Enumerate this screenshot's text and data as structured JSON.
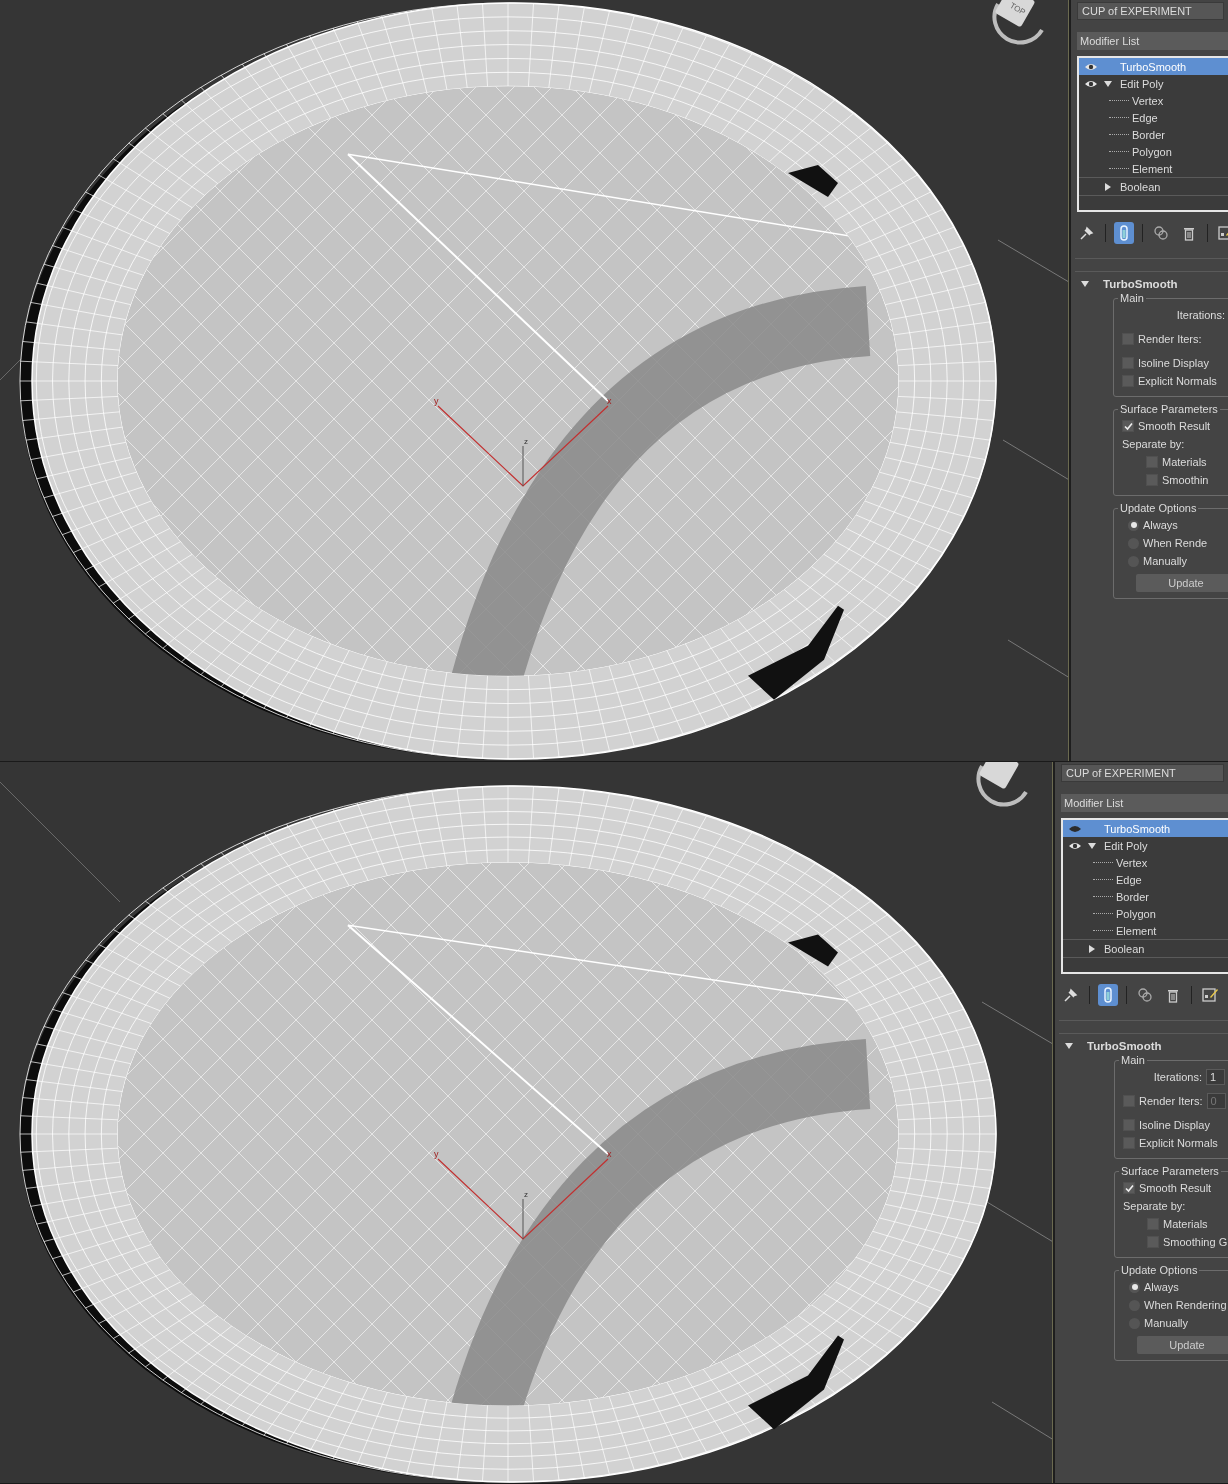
{
  "panes": [
    {
      "viewport": {
        "viewcube_label": "TOP",
        "axis_labels": [
          "y",
          "x",
          "z"
        ]
      },
      "panel": {
        "object_name": "CUP of EXPERIMENT",
        "modifier_list": "Modifier List",
        "stack": [
          {
            "label": "TurboSmooth",
            "visible": true,
            "selected": true
          },
          {
            "label": "Edit Poly",
            "visible": true,
            "selected": false,
            "expanded": true,
            "children": [
              {
                "label": "Vertex"
              },
              {
                "label": "Edge"
              },
              {
                "label": "Border"
              },
              {
                "label": "Polygon"
              },
              {
                "label": "Element"
              }
            ]
          },
          {
            "label": "Boolean",
            "selected": false,
            "expanded": false
          }
        ],
        "toolbar": [
          {
            "kind": "pin",
            "selected": false
          },
          {
            "kind": "show-end-result",
            "selected": true
          },
          {
            "kind": "make-unique",
            "selected": false
          },
          {
            "kind": "remove",
            "selected": false
          },
          {
            "kind": "configure",
            "selected": false
          }
        ],
        "rollout": {
          "title": "TurboSmooth",
          "expanded": true,
          "groups": [
            {
              "title": "Main",
              "controls": [
                {
                  "kind": "spinner",
                  "label": "Iterations:"
                },
                {
                  "kind": "checkbox",
                  "label": "Render Iters:",
                  "checked": false
                },
                {
                  "kind": "checkbox",
                  "label": "Isoline Display",
                  "checked": false
                },
                {
                  "kind": "checkbox",
                  "label": "Explicit Normals",
                  "checked": false
                }
              ]
            },
            {
              "title": "Surface Parameters",
              "controls": [
                {
                  "kind": "checkbox",
                  "label": "Smooth Result",
                  "checked": true
                },
                {
                  "kind": "label",
                  "label": "Separate by:",
                  "children": [
                    {
                      "label": "Materials",
                      "checked": false
                    },
                    {
                      "label": "Smoothin",
                      "checked": false
                    }
                  ]
                }
              ]
            },
            {
              "title": "Update Options",
              "controls": [
                {
                  "kind": "radio",
                  "label": "Always",
                  "selected": true
                },
                {
                  "kind": "radio",
                  "label": "When Rende",
                  "selected": false
                },
                {
                  "kind": "radio",
                  "label": "Manually",
                  "selected": false
                },
                {
                  "kind": "button",
                  "label": "Update"
                }
              ]
            }
          ]
        }
      }
    },
    {
      "viewport": {
        "axis_labels": [
          "y",
          "x",
          "z"
        ]
      },
      "panel": {
        "object_name": "CUP of EXPERIMENT",
        "modifier_list": "Modifier List",
        "stack": [
          {
            "label": "TurboSmooth",
            "visible": false,
            "selected": true
          },
          {
            "label": "Edit Poly",
            "visible": true,
            "selected": false,
            "expanded": true,
            "children": [
              {
                "label": "Vertex"
              },
              {
                "label": "Edge"
              },
              {
                "label": "Border"
              },
              {
                "label": "Polygon"
              },
              {
                "label": "Element"
              }
            ]
          },
          {
            "label": "Boolean",
            "selected": false,
            "expanded": false
          }
        ],
        "toolbar": [
          {
            "kind": "pin",
            "selected": false
          },
          {
            "kind": "show-end-result",
            "selected": true
          },
          {
            "kind": "make-unique",
            "selected": false
          },
          {
            "kind": "remove",
            "selected": false
          },
          {
            "kind": "configure",
            "selected": false
          }
        ],
        "rollout": {
          "title": "TurboSmooth",
          "expanded": true,
          "groups": [
            {
              "title": "Main",
              "controls": [
                {
                  "kind": "spinner",
                  "label": "Iterations:",
                  "value": "1"
                },
                {
                  "kind": "checkbox",
                  "label": "Render Iters:",
                  "checked": false,
                  "value": "0"
                },
                {
                  "kind": "checkbox",
                  "label": "Isoline Display",
                  "checked": false
                },
                {
                  "kind": "checkbox",
                  "label": "Explicit Normals",
                  "checked": false
                }
              ]
            },
            {
              "title": "Surface Parameters",
              "controls": [
                {
                  "kind": "checkbox",
                  "label": "Smooth Result",
                  "checked": true
                },
                {
                  "kind": "label",
                  "label": "Separate by:",
                  "children": [
                    {
                      "label": "Materials",
                      "checked": false
                    },
                    {
                      "label": "Smoothing G",
                      "checked": false
                    }
                  ]
                }
              ]
            },
            {
              "title": "Update Options",
              "controls": [
                {
                  "kind": "radio",
                  "label": "Always",
                  "selected": true
                },
                {
                  "kind": "radio",
                  "label": "When Rendering",
                  "selected": false
                },
                {
                  "kind": "radio",
                  "label": "Manually",
                  "selected": false
                },
                {
                  "kind": "button",
                  "label": "Update"
                }
              ]
            }
          ]
        }
      }
    }
  ]
}
